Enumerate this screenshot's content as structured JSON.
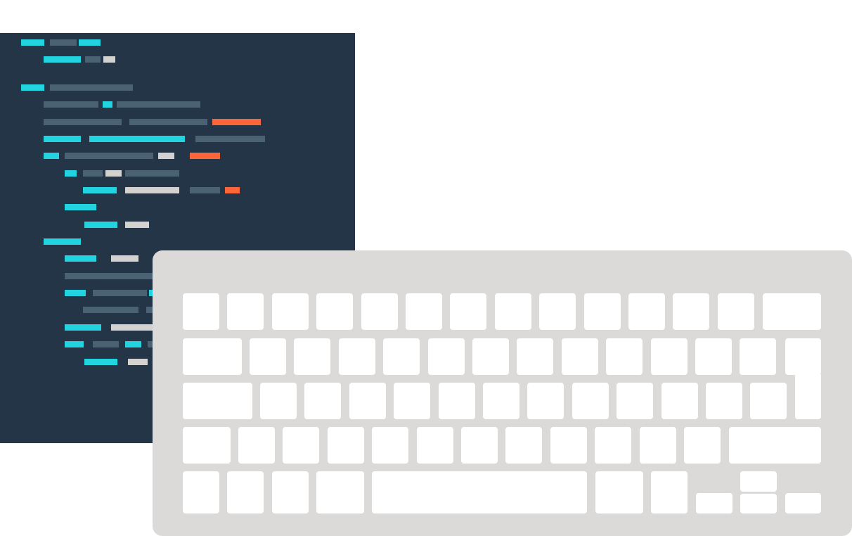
{
  "colors": {
    "panel_background": "#233547",
    "code_cyan": "#22d3e0",
    "code_slate": "#4b6275",
    "code_light": "#d3d2d0",
    "code_orange": "#fa6637",
    "keyboard_body": "#dcdad8",
    "key_face": "#ffffff"
  },
  "code_panel": {
    "icon": "code-editor-icon",
    "line_count": 20
  },
  "keyboard": {
    "icon": "keyboard-icon",
    "row_count": 5
  }
}
